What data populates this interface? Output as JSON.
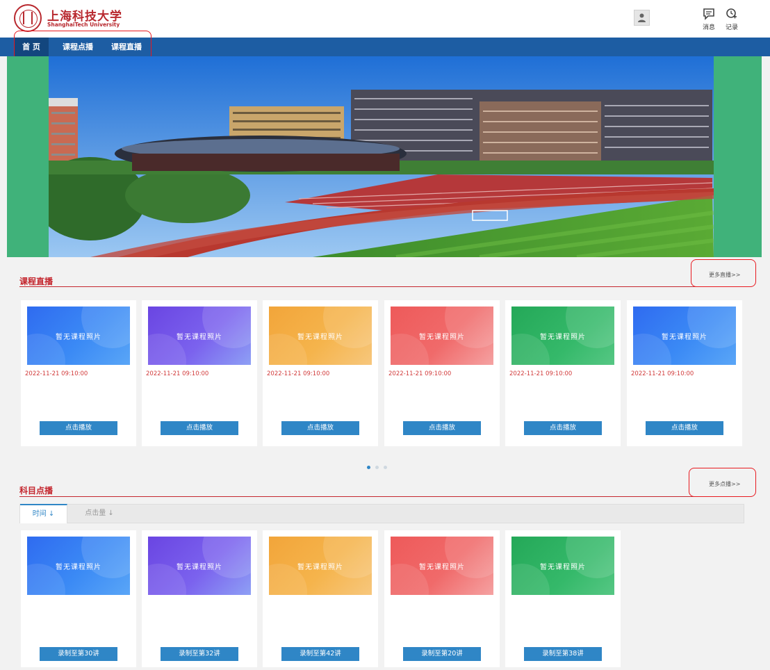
{
  "header": {
    "logo_cn": "上海科技大学",
    "logo_en": "ShanghaiTech University",
    "avatar_icon": "user-avatar-icon",
    "tools": [
      {
        "label": "消息",
        "icon": "message-icon"
      },
      {
        "label": "记录",
        "icon": "record-icon"
      }
    ]
  },
  "nav": {
    "items": [
      {
        "label": "首 页",
        "active": true
      },
      {
        "label": "课程点播",
        "active": false
      },
      {
        "label": "课程直播",
        "active": false
      }
    ]
  },
  "live_section": {
    "title": "课程直播",
    "more": "更多直播>>",
    "cards": [
      {
        "thumb_text": "暂无课程照片",
        "date": "2022-11-21 09:10:00",
        "button": "点击播放",
        "theme": "blue"
      },
      {
        "thumb_text": "暂无课程照片",
        "date": "2022-11-21 09:10:00",
        "button": "点击播放",
        "theme": "purple"
      },
      {
        "thumb_text": "暂无课程照片",
        "date": "2022-11-21 09:10:00",
        "button": "点击播放",
        "theme": "orange"
      },
      {
        "thumb_text": "暂无课程照片",
        "date": "2022-11-21 09:10:00",
        "button": "点击播放",
        "theme": "red"
      },
      {
        "thumb_text": "暂无课程照片",
        "date": "2022-11-21 09:10:00",
        "button": "点击播放",
        "theme": "green"
      },
      {
        "thumb_text": "暂无课程照片",
        "date": "2022-11-21 09:10:00",
        "button": "点击播放",
        "theme": "blue"
      }
    ],
    "pager": {
      "pages": 3,
      "current": 1
    }
  },
  "vod_section": {
    "title": "科目点播",
    "more": "更多点播>>",
    "tabs": [
      {
        "label": "时间 ↓",
        "active": true
      },
      {
        "label": "点击量 ↓",
        "active": false
      }
    ],
    "cards": [
      {
        "thumb_text": "暂无课程照片",
        "button": "录制至第30讲",
        "theme": "blue"
      },
      {
        "thumb_text": "暂无课程照片",
        "button": "录制至第32讲",
        "theme": "purple"
      },
      {
        "thumb_text": "暂无课程照片",
        "button": "录制至第42讲",
        "theme": "orange"
      },
      {
        "thumb_text": "暂无课程照片",
        "button": "录制至第20讲",
        "theme": "red"
      },
      {
        "thumb_text": "暂无课程照片",
        "button": "录制至第38讲",
        "theme": "green"
      }
    ]
  },
  "colors": {
    "brand_red": "#b8282e",
    "nav_blue": "#1d5da3",
    "button_blue": "#2f86c6",
    "banner_green": "#40b27a",
    "annotation_red": "#e8191f"
  }
}
